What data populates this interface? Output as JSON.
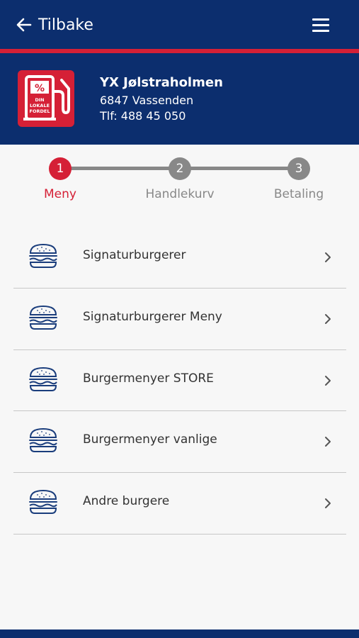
{
  "header": {
    "back_label": "Tilbake"
  },
  "station": {
    "logo_text": [
      "%",
      "DIN",
      "LOKALE",
      "FORDEL"
    ],
    "name": "YX Jølstraholmen",
    "address": "6847 Vassenden",
    "phone": "Tlf: 488 45 050"
  },
  "steps": [
    {
      "number": "1",
      "label": "Meny",
      "active": true
    },
    {
      "number": "2",
      "label": "Handlekurv",
      "active": false
    },
    {
      "number": "3",
      "label": "Betaling",
      "active": false
    }
  ],
  "menu": {
    "items": [
      {
        "label": "Signaturburgerer"
      },
      {
        "label": "Signaturburgerer Meny"
      },
      {
        "label": "Burgermenyer STORE"
      },
      {
        "label": "Burgermenyer vanlige"
      },
      {
        "label": "Andre burgere"
      }
    ]
  },
  "colors": {
    "brand_blue": "#0c2e6e",
    "brand_red": "#d52036",
    "inactive_gray": "#888888"
  },
  "icons": [
    "back-arrow-icon",
    "hamburger-menu-icon",
    "fuel-pump-logo-icon",
    "burger-icon",
    "chevron-right-icon"
  ]
}
